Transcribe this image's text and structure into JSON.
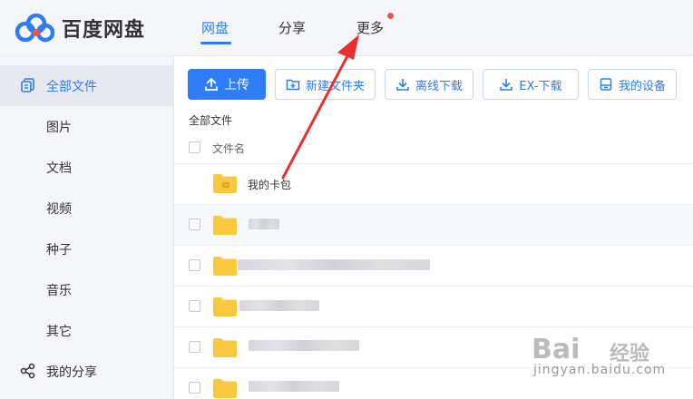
{
  "app": {
    "name": "百度网盘"
  },
  "nav": {
    "tabs": [
      {
        "label": "网盘"
      },
      {
        "label": "分享"
      },
      {
        "label": "更多"
      }
    ]
  },
  "sidebar": {
    "items": [
      {
        "label": "全部文件"
      },
      {
        "label": "图片"
      },
      {
        "label": "文档"
      },
      {
        "label": "视频"
      },
      {
        "label": "种子"
      },
      {
        "label": "音乐"
      },
      {
        "label": "其它"
      },
      {
        "label": "我的分享"
      }
    ]
  },
  "toolbar": {
    "upload": "上传",
    "new_folder": "新建文件夹",
    "offline_download": "离线下载",
    "ex_download": "EX-下载",
    "my_devices": "我的设备"
  },
  "breadcrumb": "全部文件",
  "table": {
    "column_name": "文件名"
  },
  "files": [
    {
      "name": "我的卡包"
    }
  ],
  "watermark": {
    "brand": "Bai",
    "cn": "经验",
    "url": "jingyan.baidu.com"
  },
  "colors": {
    "accent": "#2e7cf6",
    "badge": "#f2544f",
    "folder": "#f9c940",
    "annotation_arrow": "#e8302e"
  }
}
